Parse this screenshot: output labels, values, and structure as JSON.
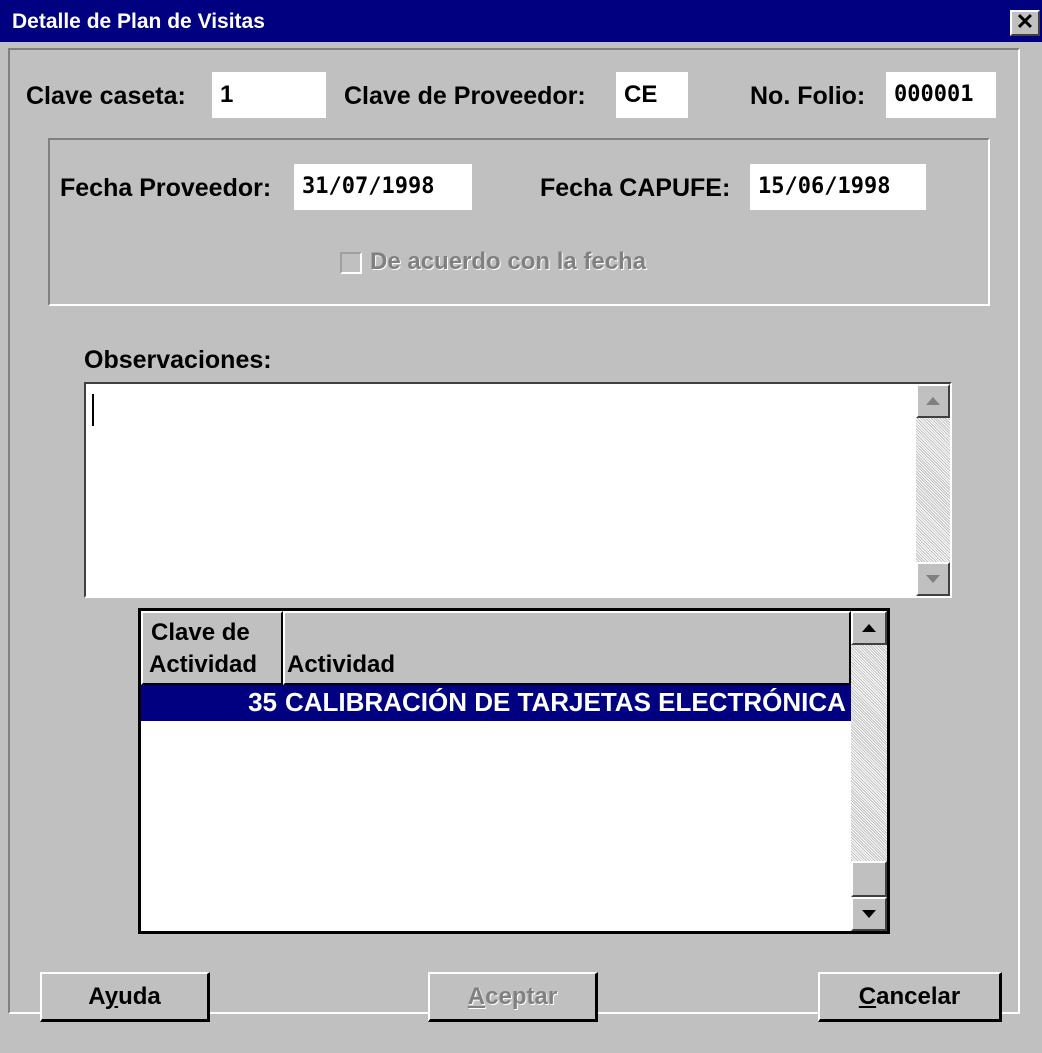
{
  "window": {
    "title": "Detalle de Plan de Visitas",
    "close_glyph": "✕"
  },
  "header_fields": {
    "clave_caseta_label": "Clave caseta:",
    "clave_caseta_value": "1",
    "clave_proveedor_label": "Clave de Proveedor:",
    "clave_proveedor_value": "CE",
    "folio_label": "No. Folio:",
    "folio_value": "000001"
  },
  "dates": {
    "fecha_proveedor_label": "Fecha Proveedor:",
    "fecha_proveedor_value": "31/07/1998",
    "fecha_capufe_label": "Fecha CAPUFE:",
    "fecha_capufe_value": "15/06/1998",
    "checkbox_label": "De acuerdo con la fecha",
    "checkbox_checked": false,
    "checkbox_enabled": false
  },
  "observaciones": {
    "label": "Observaciones:",
    "value": ""
  },
  "activities_grid": {
    "columns": [
      "Clave de\nActividad",
      "Actividad"
    ],
    "column_line1": "Clave de",
    "column_line2": "Actividad",
    "column_actividad": "Actividad",
    "rows": [
      {
        "clave": "35",
        "actividad": "CALIBRACIÓN DE TARJETAS ELECTRÓNICA",
        "selected": true
      }
    ]
  },
  "buttons": {
    "ayuda": {
      "pre": "A",
      "accel": "y",
      "post": "uda"
    },
    "aceptar": {
      "pre": "",
      "accel": "A",
      "post": "ceptar",
      "enabled": false
    },
    "cancelar": {
      "pre": "",
      "accel": "C",
      "post": "ancelar"
    }
  },
  "colors": {
    "face": "#c0c0c0",
    "title_bar": "#000080",
    "selection": "#000080"
  }
}
